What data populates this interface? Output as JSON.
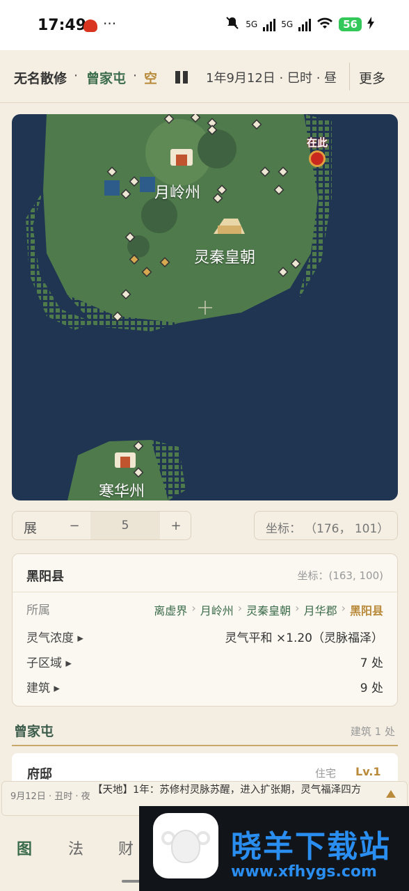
{
  "status_bar": {
    "time": "17:49",
    "dots": "···",
    "network_1": "5G",
    "network_2": "5G",
    "battery": "56"
  },
  "top_bar": {
    "player": "无名散修",
    "separator": "·",
    "location": "曾家屯",
    "extra": "空",
    "date": "1年9月12日 · 巳时 · 昼",
    "more": "更多"
  },
  "map": {
    "labels": {
      "yueling": "月岭州",
      "lingqin": "灵秦皇朝",
      "hanhua": "寒华州"
    },
    "here_label": "在此",
    "colors": {
      "ocean": "#1f3552",
      "land": "#4f7a4c",
      "forest": "#3f6240",
      "marker": "#e8e0cc"
    }
  },
  "controls": {
    "zoom_label": "展",
    "minus": "−",
    "zoom_value": "5",
    "plus": "+",
    "coord_label": "坐标：",
    "coord_value": "（176， 101）"
  },
  "region": {
    "name": "黑阳县",
    "coord": "坐标：(163, 100)",
    "belongs_label": "所属",
    "path": [
      "离虚界",
      "月岭州",
      "灵秦皇朝",
      "月华郡"
    ],
    "path_current": "黑阳县",
    "path_sep": "›",
    "qi_label": "灵气浓度 ▸",
    "qi_value": "灵气平和 ×1.20（灵脉福泽）",
    "subregion_label": "子区域 ▸",
    "subregion_value": "7 处",
    "building_label": "建筑 ▸",
    "building_value": "9 处"
  },
  "village": {
    "name": "曾家屯",
    "count": "建筑 1 处",
    "building": {
      "name": "府邸",
      "type": "住宅",
      "level": "Lv.1"
    }
  },
  "ticker": {
    "time": "9月12日 · 丑时 · 夜",
    "text": "【天地】1年：苏修村灵脉苏醒，进入扩张期，灵气福泽四方"
  },
  "nav": {
    "map": "图",
    "method": "法",
    "wealth": "财"
  },
  "watermark": {
    "title": "晓羊下载站",
    "url": "www.xfhygs.com"
  }
}
